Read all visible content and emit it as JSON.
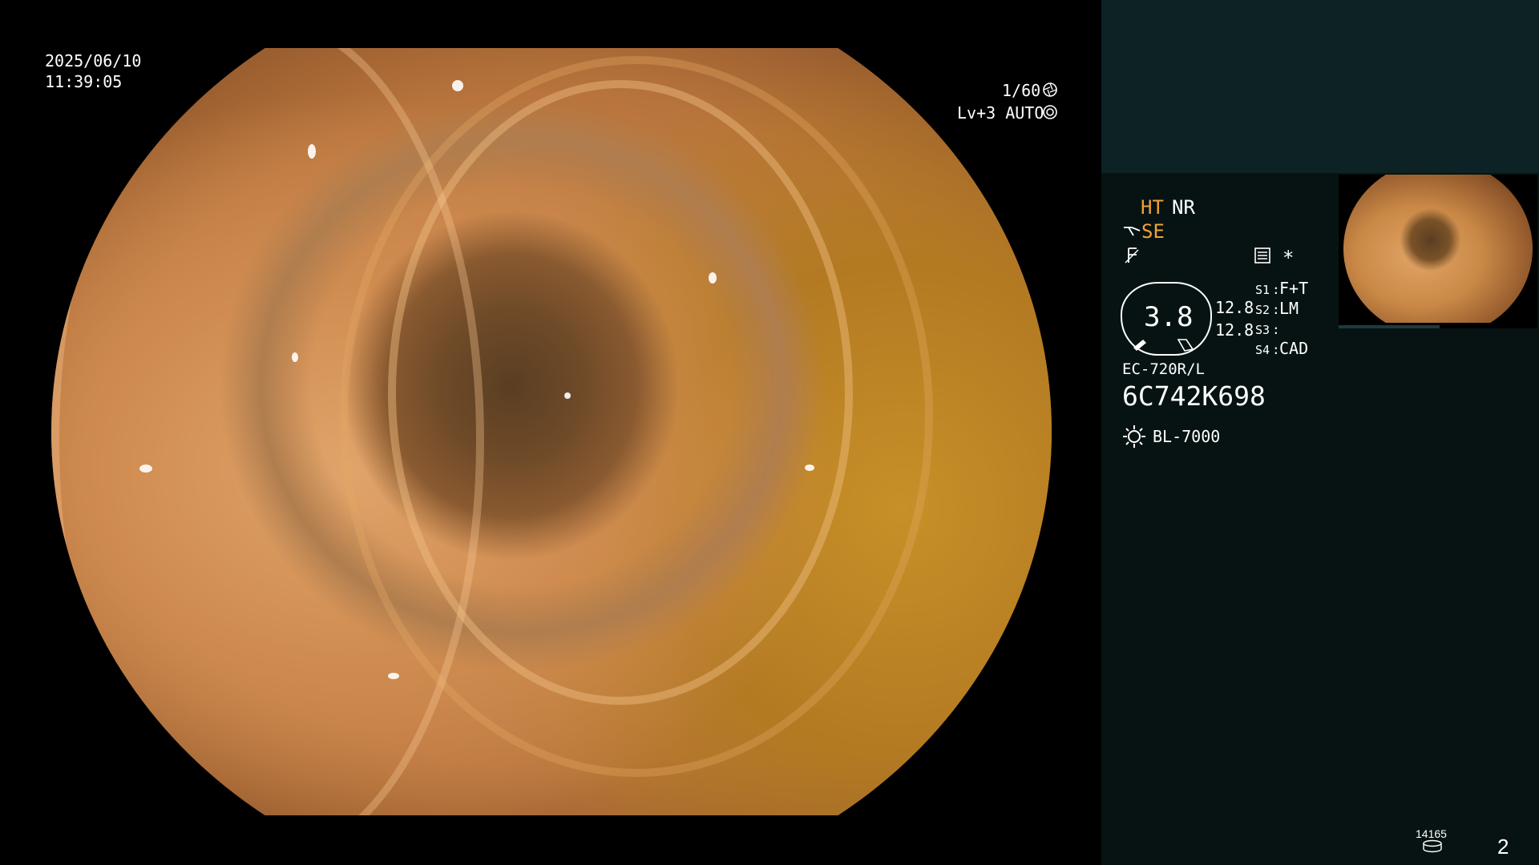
{
  "overlay": {
    "date": "2025/06/10",
    "time": "11:39:05",
    "shutter": "1/60",
    "shutter_icon": "aperture-icon",
    "level": "Lv+3 AUTO",
    "level_icon": "iris-icon"
  },
  "panel": {
    "ht": "HT",
    "nr": "NR",
    "se": "SE",
    "se_icon": "scope-tip-icon",
    "f_icon": "freeze-icon",
    "settings_icon": "settings-icon",
    "star": "*",
    "gauge_value": "3.8",
    "readout_top": "12.8",
    "readout_bottom": "12.8",
    "switches": [
      {
        "label": "S1",
        "value": "F+T"
      },
      {
        "label": "S2",
        "value": "LM"
      },
      {
        "label": "S3",
        "value": ""
      },
      {
        "label": "S4",
        "value": "CAD"
      }
    ],
    "scope_model": "EC-720R/L",
    "scope_serial": "6C742K698",
    "light_icon": "light-source-icon",
    "light_source": "BL-7000",
    "counter": "14165",
    "counter_icon": "disk-icon",
    "page": "2"
  },
  "colors": {
    "panel_bg": "#071313",
    "panel_top_bg": "#0c2224",
    "accent_orange": "#f0a236"
  }
}
